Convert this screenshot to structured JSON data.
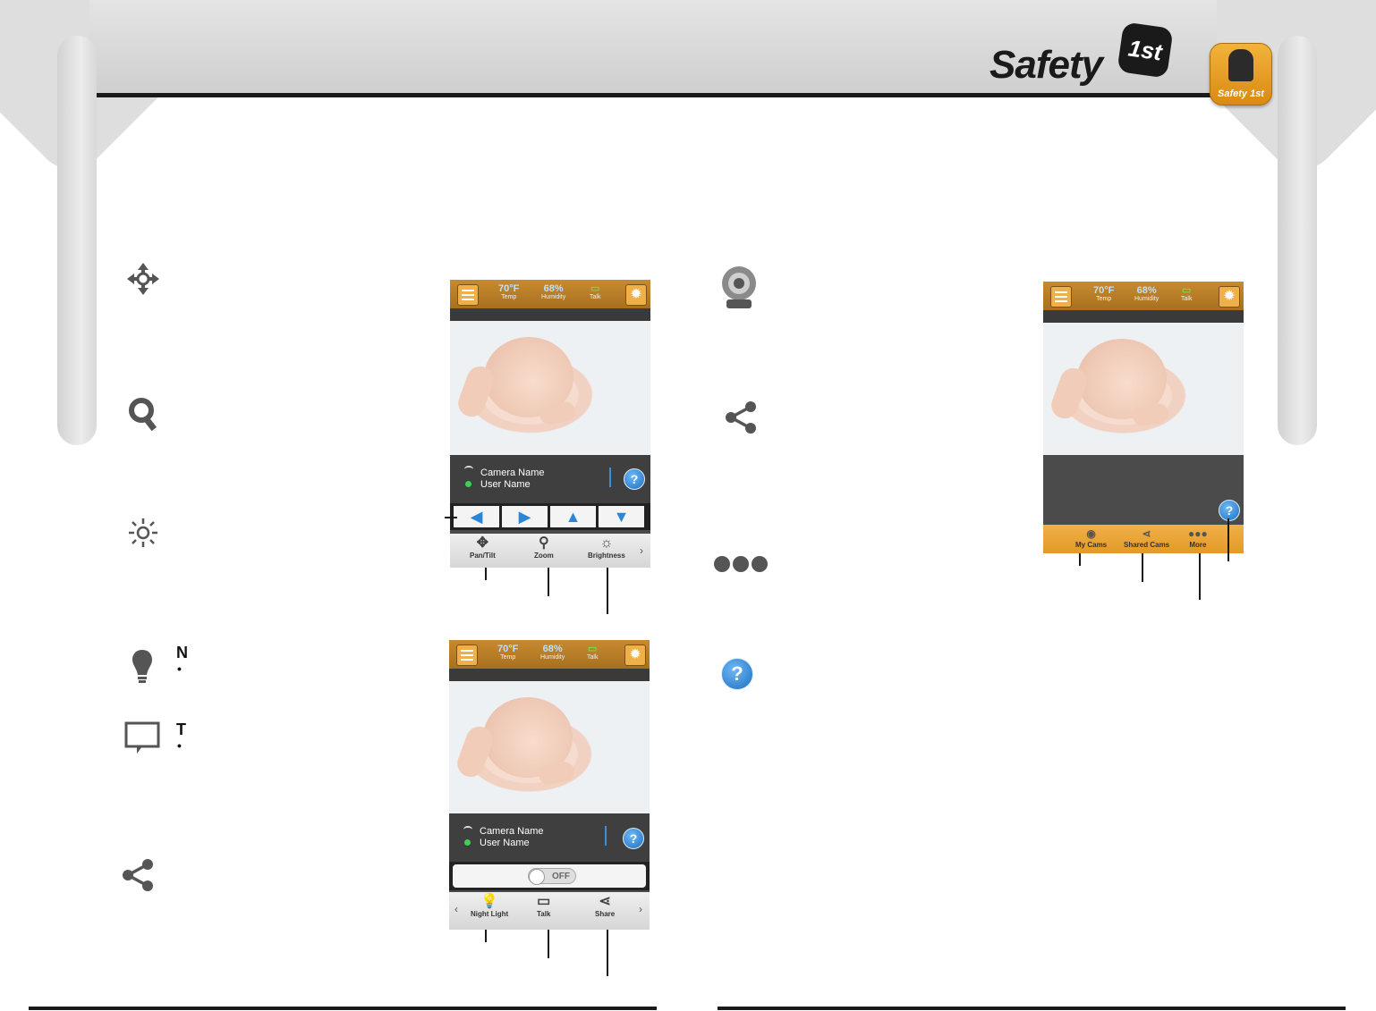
{
  "brand": {
    "logo_text": "Safety",
    "logo_badge": "1st",
    "app_icon_label": "Safety 1st"
  },
  "left_icons": [
    {
      "name": "pan-tilt-icon"
    },
    {
      "name": "zoom-icon"
    },
    {
      "name": "brightness-icon"
    },
    {
      "name": "night-light-icon",
      "cut_text": "N",
      "bullet": "•"
    },
    {
      "name": "talk-icon",
      "cut_text": "T",
      "bullet": "•"
    },
    {
      "name": "share-icon"
    }
  ],
  "right_icons": [
    {
      "name": "my-cams-icon"
    },
    {
      "name": "shared-cams-icon"
    },
    {
      "name": "more-icon"
    },
    {
      "name": "help-icon",
      "label": "?"
    }
  ],
  "phone_common": {
    "temp_value": "70°F",
    "temp_label": "Temp",
    "humidity_value": "68%",
    "humidity_label": "Humidity",
    "talk_label": "Talk",
    "camera_name": "Camera Name",
    "user_name": "User Name",
    "help": "?"
  },
  "phone1": {
    "direction_buttons": [
      "◀",
      "▶",
      "▲",
      "▼"
    ],
    "toolbar": [
      {
        "icon": "✥",
        "label": "Pan/Tilt"
      },
      {
        "icon": "⚲",
        "label": "Zoom"
      },
      {
        "icon": "☼",
        "label": "Brightness"
      }
    ],
    "right_arrow": "›"
  },
  "phone2": {
    "toggle_label": "OFF",
    "toolbar": [
      {
        "icon": "💡",
        "label": "Night Light"
      },
      {
        "icon": "▭",
        "label": "Talk"
      },
      {
        "icon": "⋖",
        "label": "Share"
      }
    ],
    "left_arrow": "‹",
    "right_arrow": "›"
  },
  "phone3": {
    "tabs": [
      {
        "icon": "◉",
        "label": "My Cams"
      },
      {
        "icon": "⋖",
        "label": "Shared Cams"
      },
      {
        "icon": "●●●",
        "label": "More"
      }
    ]
  },
  "colors": {
    "accent_orange": "#e29a25",
    "help_blue": "#1e6fc0",
    "header_gray": "#d8d8d8"
  }
}
